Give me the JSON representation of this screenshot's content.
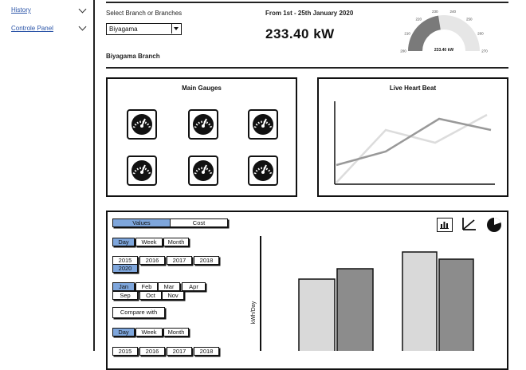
{
  "sidebar": {
    "items": [
      {
        "label": "History"
      },
      {
        "label": "Controle Panel"
      }
    ]
  },
  "header": {
    "branch_select_label": "Select Branch or Branches",
    "branch_selected": "Biyagama",
    "date_range": "From 1st - 25th January 2020",
    "power_value": "233.40 kW",
    "branch_title": "Biyagama Branch"
  },
  "power_gauge": {
    "value_label": "233.40 kW",
    "ticks": [
      "200",
      "210",
      "220",
      "230",
      "240",
      "250",
      "260",
      "270"
    ],
    "fill_fraction": 0.45,
    "colors": {
      "fill": "#7a7a7a",
      "track": "#e6e6e6"
    }
  },
  "main_gauges": {
    "title": "Main Gauges",
    "count": 6
  },
  "heartbeat": {
    "title": "Live Heart Beat",
    "colors": {
      "series_dark": "#999999",
      "series_light": "#dcdcdc"
    }
  },
  "controls": {
    "mode_tabs": [
      {
        "label": "Values",
        "active": true
      },
      {
        "label": "Cost",
        "active": false
      }
    ],
    "period_tabs_1": [
      {
        "label": "Day",
        "active": true
      },
      {
        "label": "Week",
        "active": false
      },
      {
        "label": "Month",
        "active": false
      }
    ],
    "years": [
      {
        "label": "2015",
        "active": false
      },
      {
        "label": "2016",
        "active": false
      },
      {
        "label": "2017",
        "active": false
      },
      {
        "label": "2018",
        "active": false
      },
      {
        "label": "2020",
        "active": true
      }
    ],
    "months": [
      {
        "label": "Jan",
        "active": true
      },
      {
        "label": "Feb",
        "active": false
      },
      {
        "label": "Mar",
        "active": false
      },
      {
        "label": "Apr",
        "active": false
      },
      {
        "label": "Sep",
        "active": false
      },
      {
        "label": "Oct",
        "active": false
      },
      {
        "label": "Nov",
        "active": false
      }
    ],
    "compare_label": "Compare with",
    "period_tabs_2": [
      {
        "label": "Day",
        "active": true
      },
      {
        "label": "Week",
        "active": false
      },
      {
        "label": "Month",
        "active": false
      }
    ],
    "accent_color": "#7ea6dc"
  },
  "chart_icons": [
    "bar-chart-icon",
    "line-chart-icon",
    "pie-chart-icon"
  ],
  "bar_chart": {
    "ylabel": "kWh/Day",
    "colors": {
      "light": "#d9d9d9",
      "dark": "#8c8c8c"
    }
  }
}
